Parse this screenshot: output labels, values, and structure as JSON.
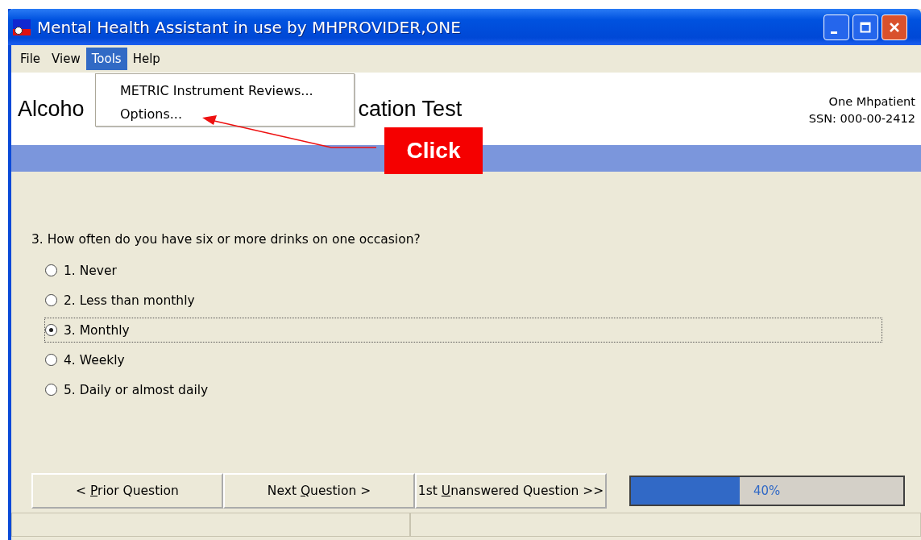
{
  "window": {
    "title": "Mental Health Assistant in use by MHPROVIDER,ONE"
  },
  "menu_bar": [
    {
      "label": "File",
      "selected": false
    },
    {
      "label": "View",
      "selected": false
    },
    {
      "label": "Tools",
      "selected": true
    },
    {
      "label": "Help",
      "selected": false
    }
  ],
  "dropdown_menu": [
    "METRIC Instrument Reviews...",
    "Options..."
  ],
  "heading": {
    "visible_start": "Alcoho",
    "visible_end": "cation Test"
  },
  "patient": {
    "name": "One Mhpatient",
    "ssn": "SSN: 000-00-2412"
  },
  "question": "3. How often do you have six or more drinks on one occasion?",
  "options": [
    {
      "label": "1. Never",
      "selected": false
    },
    {
      "label": "2. Less than monthly",
      "selected": false
    },
    {
      "label": "3. Monthly",
      "selected": true
    },
    {
      "label": "4. Weekly",
      "selected": false
    },
    {
      "label": "5. Daily or almost daily",
      "selected": false
    }
  ],
  "buttons": [
    {
      "before": "< ",
      "key": "P",
      "after": "rior Question"
    },
    {
      "before": "Next ",
      "key": "Q",
      "after": "uestion >"
    },
    {
      "before": "1st ",
      "key": "U",
      "after": "nanswered Question >>"
    }
  ],
  "progress": {
    "level": 0.4,
    "reading": "40%"
  },
  "callout": {
    "label": "Click"
  }
}
